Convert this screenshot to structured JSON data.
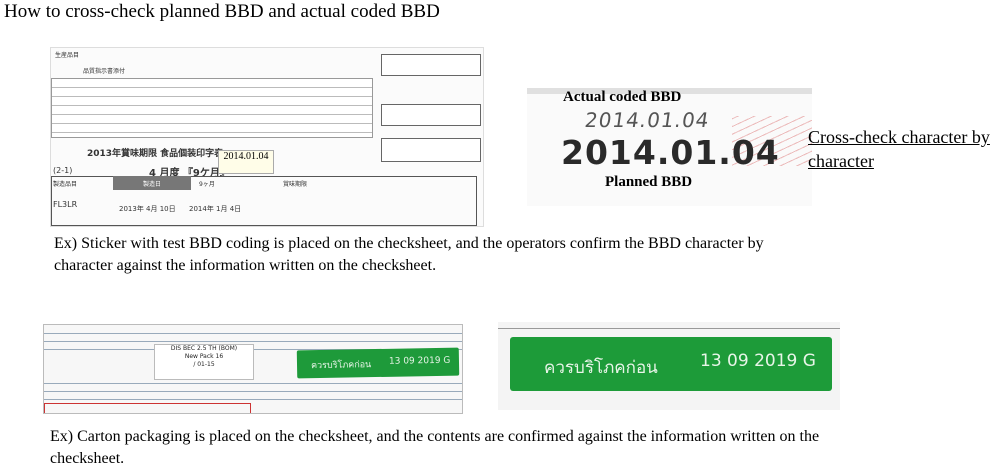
{
  "title": "How to cross-check planned BBD and actual coded BBD",
  "cross_check": "Cross-check character by character",
  "captions": {
    "first": "Ex) Sticker with test BBD coding is placed on the checksheet, and the operators confirm the BBD character by character against the information written on the checksheet.",
    "second": "Ex) Carton packaging is placed on the checksheet, and the contents are confirmed against the information written on the checksheet."
  },
  "date_photo": {
    "actual_label": "Actual coded BBD",
    "planned_label": "Planned BBD",
    "actual_date": "2014.01.04",
    "planned_date": "2014.01.04"
  },
  "checksheet": {
    "header": "生産品目",
    "subheader": "品質指示書添付",
    "table_title": "2013年賞味期限 食品個装印字表",
    "section": "(2-1)",
    "month": "4 月度 『9ケ月』",
    "col_product": "製造品目",
    "col_date": "製造日",
    "col_period": "9ヶ月",
    "col_bbd": "賞味期限",
    "row_code": "FL3LR",
    "row_mfg": "2013年 4月 10日",
    "row_bbd": "2014年 1月 4日",
    "row_stamp": "2014.01.04"
  },
  "carton": {
    "sticker_lines": [
      "DIS BEC 2.5 TH (BOM)",
      "New Pack 16",
      "/ 01-15"
    ],
    "strip_text": "ควรบริโภคก่อน",
    "strip_date": "13 09 2019 G"
  }
}
